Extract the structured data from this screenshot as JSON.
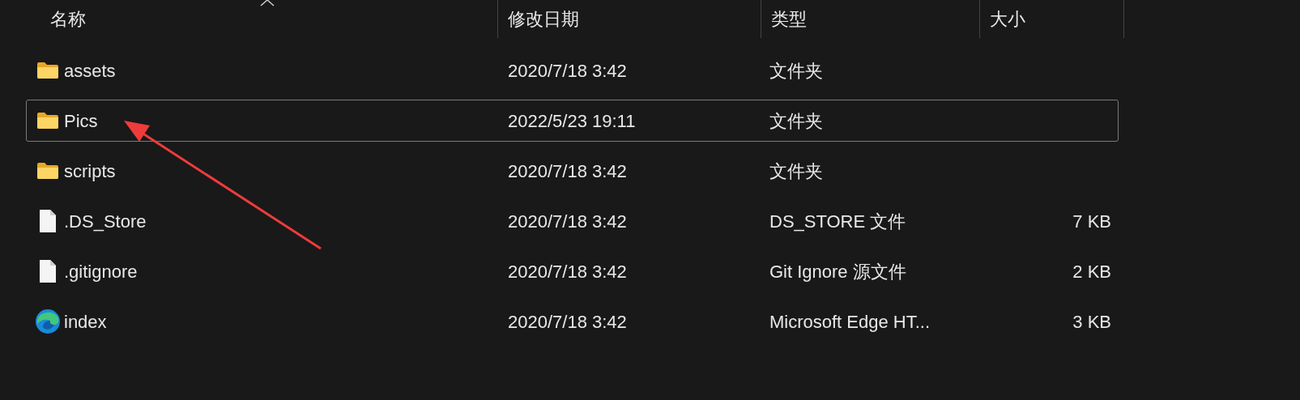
{
  "columns": [
    "名称",
    "修改日期",
    "类型",
    "大小"
  ],
  "rows": [
    {
      "kind": "folder",
      "name": "assets",
      "modified": "2020/7/18 3:42",
      "type": "文件夹",
      "focused": false
    },
    {
      "kind": "folder",
      "name": "Pics",
      "modified": "2022/5/23 19:11",
      "type": "文件夹",
      "focused": true
    },
    {
      "kind": "folder",
      "name": "scripts",
      "modified": "2020/7/18 3:42",
      "type": "文件夹",
      "focused": false
    },
    {
      "kind": "file",
      "name": ".DS_Store",
      "modified": "2020/7/18 3:42",
      "type": "DS_STORE 文件",
      "size": "7 KB",
      "focused": false
    },
    {
      "kind": "file",
      "name": ".gitignore",
      "modified": "2020/7/18 3:42",
      "type": "Git Ignore 源文件",
      "size": "2 KB",
      "focused": false
    },
    {
      "kind": "edge",
      "name": "index",
      "modified": "2020/7/18 3:42",
      "type": "Microsoft Edge HT...",
      "size": "3 KB",
      "focused": false
    }
  ]
}
